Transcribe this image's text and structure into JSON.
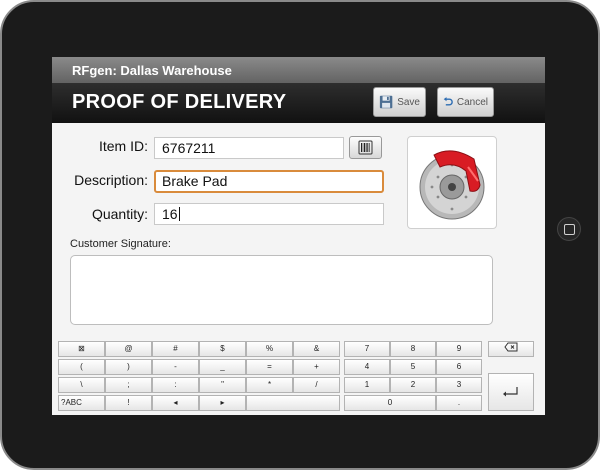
{
  "app": {
    "title": "RFgen: Dallas Warehouse"
  },
  "header": {
    "title": "PROOF OF DELIVERY",
    "save_label": "Save",
    "cancel_label": "Cancel"
  },
  "form": {
    "item_id": {
      "label": "Item ID:",
      "value": "6767211"
    },
    "description": {
      "label": "Description:",
      "value": "Brake Pad"
    },
    "quantity": {
      "label": "Quantity:",
      "value": "16"
    },
    "signature": {
      "label": "Customer Signature:"
    }
  },
  "colors": {
    "focus_border": "#d98b3c",
    "header_bg": "#1a1a1a",
    "titlebar_bg": "#777777",
    "caliper_red": "#d81c24"
  },
  "keyboard": {
    "symbols": [
      [
        "⊠",
        "@",
        "#",
        "$",
        "%",
        "&"
      ],
      [
        "(",
        ")",
        "-",
        "_",
        "=",
        "+"
      ],
      [
        "\\",
        ";",
        ":",
        "\"",
        "*",
        "/"
      ],
      [
        "?ABC",
        "!",
        "◂",
        "▸",
        ""
      ]
    ],
    "numpad": [
      [
        "7",
        "8",
        "9"
      ],
      [
        "4",
        "5",
        "6"
      ],
      [
        "1",
        "2",
        "3"
      ],
      [
        "0",
        "."
      ]
    ],
    "backspace_icon": "backspace-icon",
    "enter_icon": "enter-icon"
  }
}
